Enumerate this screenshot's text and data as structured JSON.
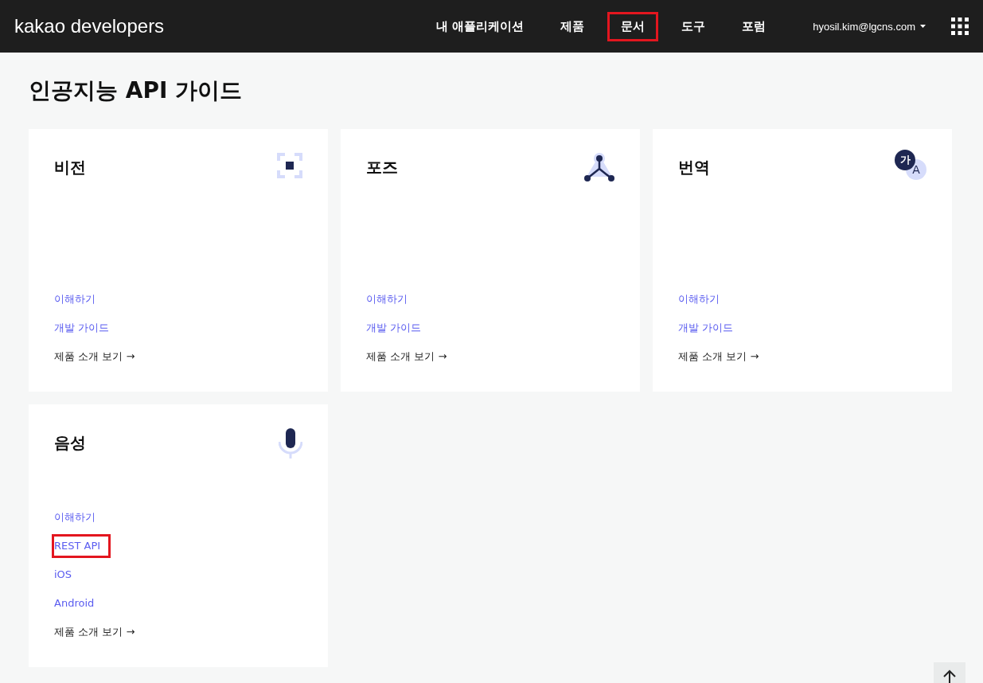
{
  "header": {
    "logo": "kakao developers",
    "nav": [
      {
        "label": "내 애플리케이션",
        "highlighted": false
      },
      {
        "label": "제품",
        "highlighted": false
      },
      {
        "label": "문서",
        "highlighted": true
      },
      {
        "label": "도구",
        "highlighted": false
      },
      {
        "label": "포럼",
        "highlighted": false
      }
    ],
    "account": "hyosil.kim@lgcns.com"
  },
  "page_title": "인공지능 API 가이드",
  "cards": [
    {
      "title": "비전",
      "kind": "vision",
      "links": [
        {
          "label": "이해하기",
          "kind": "doc",
          "highlighted": false
        },
        {
          "label": "개발 가이드",
          "kind": "doc",
          "highlighted": false
        },
        {
          "label": "제품 소개 보기 →",
          "kind": "more",
          "highlighted": false
        }
      ]
    },
    {
      "title": "포즈",
      "kind": "pose",
      "links": [
        {
          "label": "이해하기",
          "kind": "doc",
          "highlighted": false
        },
        {
          "label": "개발 가이드",
          "kind": "doc",
          "highlighted": false
        },
        {
          "label": "제품 소개 보기 →",
          "kind": "more",
          "highlighted": false
        }
      ]
    },
    {
      "title": "번역",
      "kind": "translate",
      "icon_labels": [
        "가",
        "A"
      ],
      "links": [
        {
          "label": "이해하기",
          "kind": "doc",
          "highlighted": false
        },
        {
          "label": "개발 가이드",
          "kind": "doc",
          "highlighted": false
        },
        {
          "label": "제품 소개 보기 →",
          "kind": "more",
          "highlighted": false
        }
      ]
    },
    {
      "title": "음성",
      "kind": "voice",
      "links": [
        {
          "label": "이해하기",
          "kind": "doc",
          "highlighted": false
        },
        {
          "label": "REST API",
          "kind": "doc",
          "highlighted": true
        },
        {
          "label": "iOS",
          "kind": "doc",
          "highlighted": false
        },
        {
          "label": "Android",
          "kind": "doc",
          "highlighted": false
        },
        {
          "label": "제품 소개 보기 →",
          "kind": "more",
          "highlighted": false
        }
      ]
    }
  ]
}
